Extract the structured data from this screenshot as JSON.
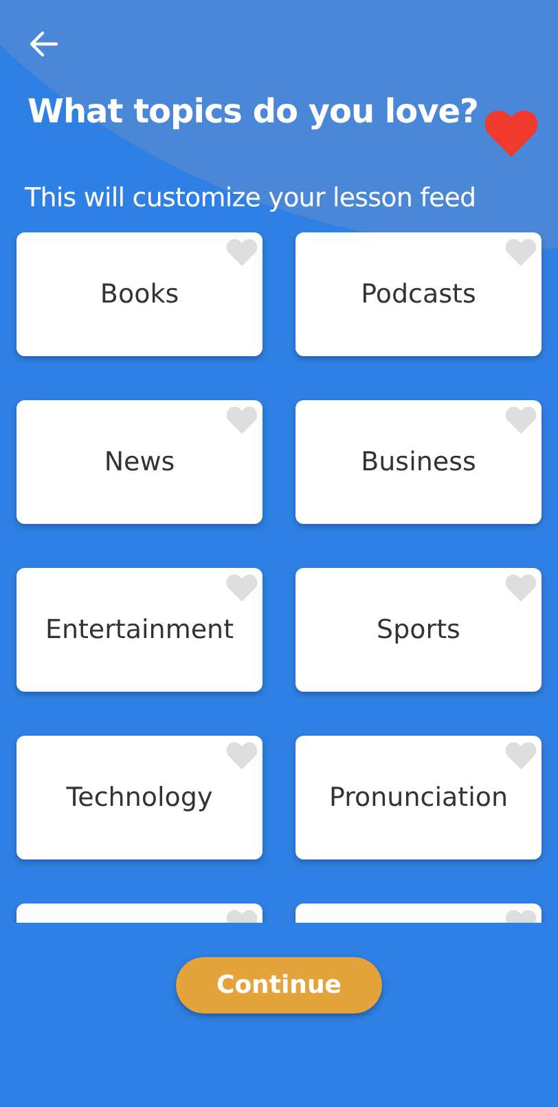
{
  "title": "What topics do you love?",
  "subtitle": "This will customize your lesson feed",
  "topics": [
    {
      "label": "Books",
      "liked": false
    },
    {
      "label": "Podcasts",
      "liked": false
    },
    {
      "label": "News",
      "liked": false
    },
    {
      "label": "Business",
      "liked": false
    },
    {
      "label": "Entertainment",
      "liked": false
    },
    {
      "label": "Sports",
      "liked": false
    },
    {
      "label": "Technology",
      "liked": false
    },
    {
      "label": "Pronunciation",
      "liked": false
    },
    {
      "liked": false
    },
    {
      "liked": false
    }
  ],
  "continue_button": "Continue"
}
